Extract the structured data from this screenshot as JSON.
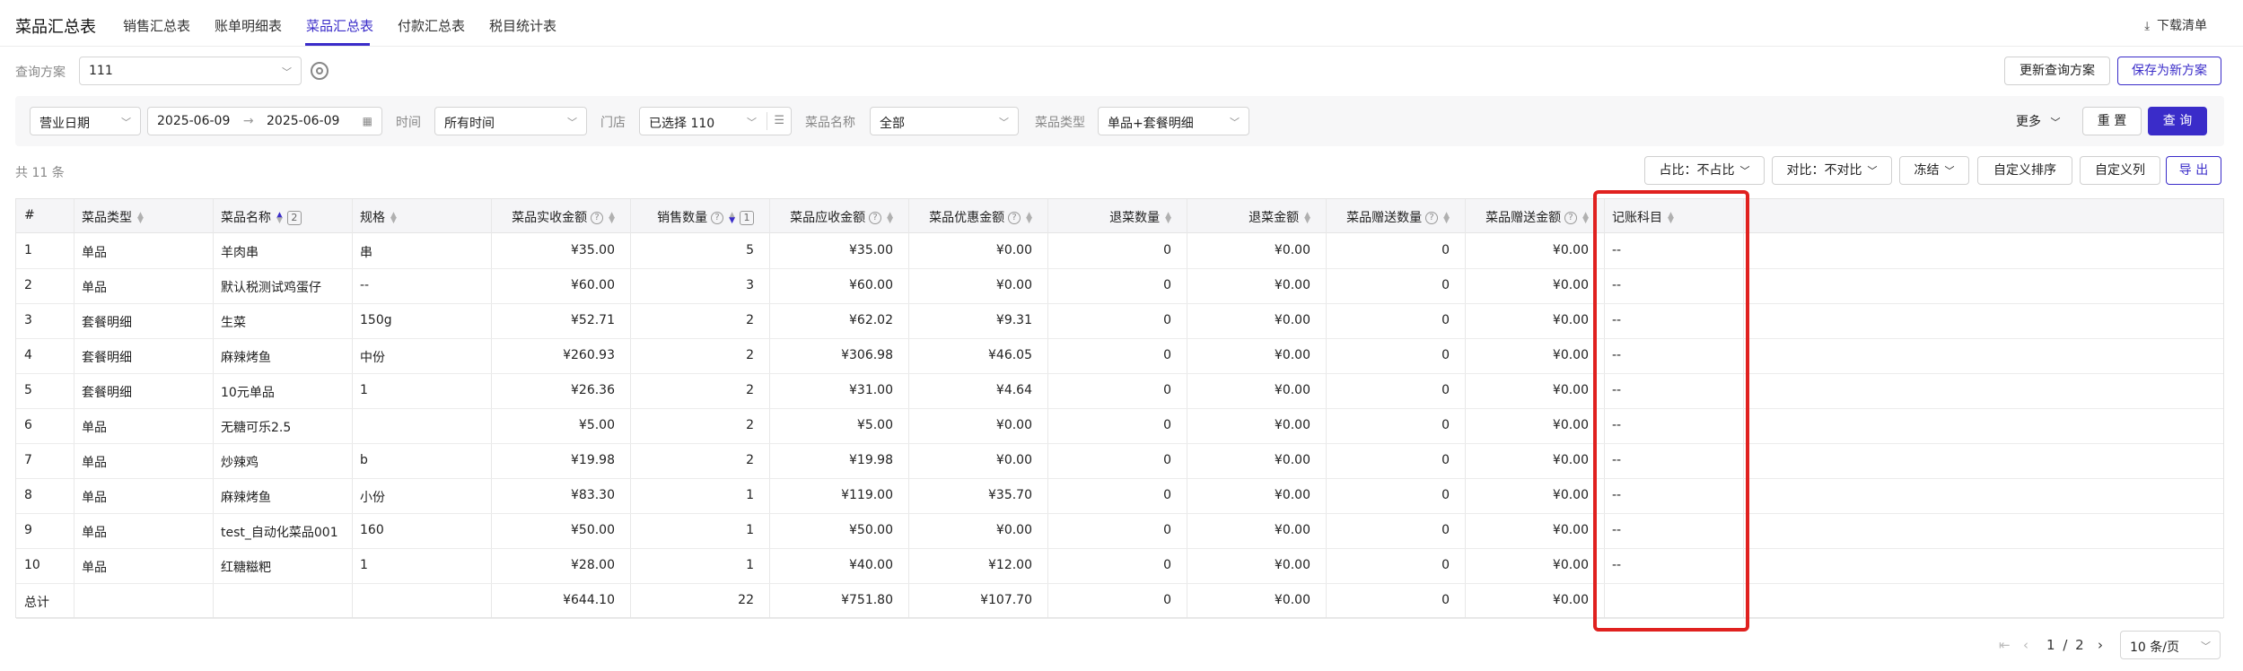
{
  "header": {
    "title": "菜品汇总表",
    "tabs": [
      {
        "label": "销售汇总表",
        "active": false
      },
      {
        "label": "账单明细表",
        "active": false
      },
      {
        "label": "菜品汇总表",
        "active": true
      },
      {
        "label": "付款汇总表",
        "active": false
      },
      {
        "label": "税目统计表",
        "active": false
      }
    ],
    "download_label": "下载清单",
    "download_icon": "download-icon"
  },
  "scheme": {
    "label": "查询方案",
    "value": "111",
    "update_button": "更新查询方案",
    "save_new_button": "保存为新方案"
  },
  "filters": {
    "date_type": "营业日期",
    "date_start": "2025-06-09",
    "date_end": "2025-06-09",
    "date_separator": "→",
    "time_label": "时间",
    "time_value": "所有时间",
    "store_label": "门店",
    "store_value": "已选择 110",
    "dish_name_label": "菜品名称",
    "dish_name_value": "全部",
    "dish_type_label": "菜品类型",
    "dish_type_value": "单品+套餐明细",
    "more_label": "更多",
    "reset_button": "重 置",
    "query_button": "查 询"
  },
  "toolbar": {
    "count_text": "共 11 条",
    "ratio_select": "占比：不占比",
    "compare_select": "对比：不对比",
    "freeze_select": "冻结",
    "custom_sort_button": "自定义排序",
    "custom_columns_button": "自定义列",
    "export_button": "导 出"
  },
  "table": {
    "headers": {
      "index": "#",
      "type": "菜品类型",
      "name": "菜品名称",
      "name_rank": "2",
      "spec": "规格",
      "actual_amount": "菜品实收金额",
      "sales_qty": "销售数量",
      "sales_qty_rank": "1",
      "receivable": "菜品应收金额",
      "discount": "菜品优惠金额",
      "return_qty": "退菜数量",
      "return_amount": "退菜金额",
      "gift_qty": "菜品赠送数量",
      "gift_amount": "菜品赠送金额",
      "account_item": "记账科目"
    },
    "rows": [
      {
        "index": "1",
        "type": "单品",
        "name": "羊肉串",
        "spec": "串",
        "actual_amount": "¥35.00",
        "sales_qty": "5",
        "receivable": "¥35.00",
        "discount": "¥0.00",
        "return_qty": "0",
        "return_amount": "¥0.00",
        "gift_qty": "0",
        "gift_amount": "¥0.00",
        "account_item": "--"
      },
      {
        "index": "2",
        "type": "单品",
        "name": "默认税测试鸡蛋仔",
        "spec": "--",
        "actual_amount": "¥60.00",
        "sales_qty": "3",
        "receivable": "¥60.00",
        "discount": "¥0.00",
        "return_qty": "0",
        "return_amount": "¥0.00",
        "gift_qty": "0",
        "gift_amount": "¥0.00",
        "account_item": "--"
      },
      {
        "index": "3",
        "type": "套餐明细",
        "name": "生菜",
        "spec": "150g",
        "actual_amount": "¥52.71",
        "sales_qty": "2",
        "receivable": "¥62.02",
        "discount": "¥9.31",
        "return_qty": "0",
        "return_amount": "¥0.00",
        "gift_qty": "0",
        "gift_amount": "¥0.00",
        "account_item": "--"
      },
      {
        "index": "4",
        "type": "套餐明细",
        "name": "麻辣烤鱼",
        "spec": "中份",
        "actual_amount": "¥260.93",
        "sales_qty": "2",
        "receivable": "¥306.98",
        "discount": "¥46.05",
        "return_qty": "0",
        "return_amount": "¥0.00",
        "gift_qty": "0",
        "gift_amount": "¥0.00",
        "account_item": "--"
      },
      {
        "index": "5",
        "type": "套餐明细",
        "name": "10元单品",
        "spec": "1",
        "actual_amount": "¥26.36",
        "sales_qty": "2",
        "receivable": "¥31.00",
        "discount": "¥4.64",
        "return_qty": "0",
        "return_amount": "¥0.00",
        "gift_qty": "0",
        "gift_amount": "¥0.00",
        "account_item": "--"
      },
      {
        "index": "6",
        "type": "单品",
        "name": "无糖可乐2.5",
        "spec": "",
        "actual_amount": "¥5.00",
        "sales_qty": "2",
        "receivable": "¥5.00",
        "discount": "¥0.00",
        "return_qty": "0",
        "return_amount": "¥0.00",
        "gift_qty": "0",
        "gift_amount": "¥0.00",
        "account_item": "--"
      },
      {
        "index": "7",
        "type": "单品",
        "name": "炒辣鸡",
        "spec": "b",
        "actual_amount": "¥19.98",
        "sales_qty": "2",
        "receivable": "¥19.98",
        "discount": "¥0.00",
        "return_qty": "0",
        "return_amount": "¥0.00",
        "gift_qty": "0",
        "gift_amount": "¥0.00",
        "account_item": "--"
      },
      {
        "index": "8",
        "type": "单品",
        "name": "麻辣烤鱼",
        "spec": "小份",
        "actual_amount": "¥83.30",
        "sales_qty": "1",
        "receivable": "¥119.00",
        "discount": "¥35.70",
        "return_qty": "0",
        "return_amount": "¥0.00",
        "gift_qty": "0",
        "gift_amount": "¥0.00",
        "account_item": "--"
      },
      {
        "index": "9",
        "type": "单品",
        "name": "test_自动化菜品001",
        "spec": "160",
        "actual_amount": "¥50.00",
        "sales_qty": "1",
        "receivable": "¥50.00",
        "discount": "¥0.00",
        "return_qty": "0",
        "return_amount": "¥0.00",
        "gift_qty": "0",
        "gift_amount": "¥0.00",
        "account_item": "--"
      },
      {
        "index": "10",
        "type": "单品",
        "name": "红糖糍粑",
        "spec": "1",
        "actual_amount": "¥28.00",
        "sales_qty": "1",
        "receivable": "¥40.00",
        "discount": "¥12.00",
        "return_qty": "0",
        "return_amount": "¥0.00",
        "gift_qty": "0",
        "gift_amount": "¥0.00",
        "account_item": "--"
      }
    ],
    "total": {
      "index": "总计",
      "actual_amount": "¥644.10",
      "sales_qty": "22",
      "receivable": "¥751.80",
      "discount": "¥107.70",
      "return_qty": "0",
      "return_amount": "¥0.00",
      "gift_qty": "0",
      "gift_amount": "¥0.00"
    }
  },
  "pagination": {
    "current": "1",
    "separator": "/",
    "total": "2",
    "page_size": "10 条/页"
  },
  "colors": {
    "accent": "#3a2cc9",
    "highlight": "#e0211f"
  }
}
